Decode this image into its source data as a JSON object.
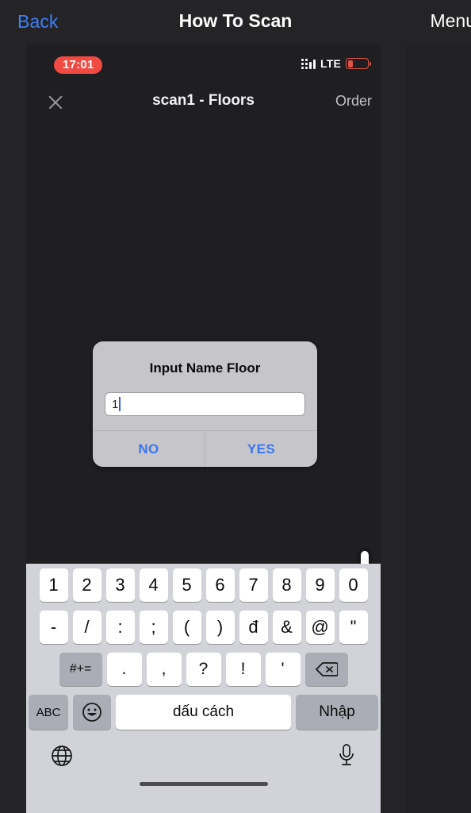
{
  "app_header": {
    "back_label": "Back",
    "title": "How To Scan",
    "menu_label": "Menu"
  },
  "phone": {
    "status_bar": {
      "recording_time": "17:01",
      "carrier_tech": "LTE",
      "signal_icon": "signal-dots-icon",
      "battery_icon": "battery-low-icon",
      "battery_color": "#e0534b"
    },
    "nav_bar": {
      "close_icon": "close-x-icon",
      "title": "scan1 - Floors",
      "order_label": "Order"
    },
    "dialog": {
      "title": "Input Name Floor",
      "input_value": "1",
      "input_placeholder": "",
      "no_label": "NO",
      "yes_label": "YES",
      "accent_color": "#3a75f0"
    },
    "cursor": {
      "icon": "pointing-hand-cursor"
    },
    "keyboard": {
      "row1": [
        "1",
        "2",
        "3",
        "4",
        "5",
        "6",
        "7",
        "8",
        "9",
        "0"
      ],
      "row2": [
        "-",
        "/",
        ":",
        ";",
        "(",
        ")",
        "đ",
        "&",
        "@",
        "\""
      ],
      "row3_symbols_label": "#+=",
      "row3": [
        ".",
        ",",
        "?",
        "!",
        "'"
      ],
      "row3_backspace_icon": "backspace-icon",
      "row4": {
        "abc_label": "ABC",
        "emoji_icon": "emoji-smiley-icon",
        "space_label": "dấu cách",
        "enter_label": "Nhập"
      },
      "bottom": {
        "globe_icon": "globe-icon",
        "mic_icon": "microphone-icon",
        "home_indicator": "home-indicator"
      }
    }
  }
}
